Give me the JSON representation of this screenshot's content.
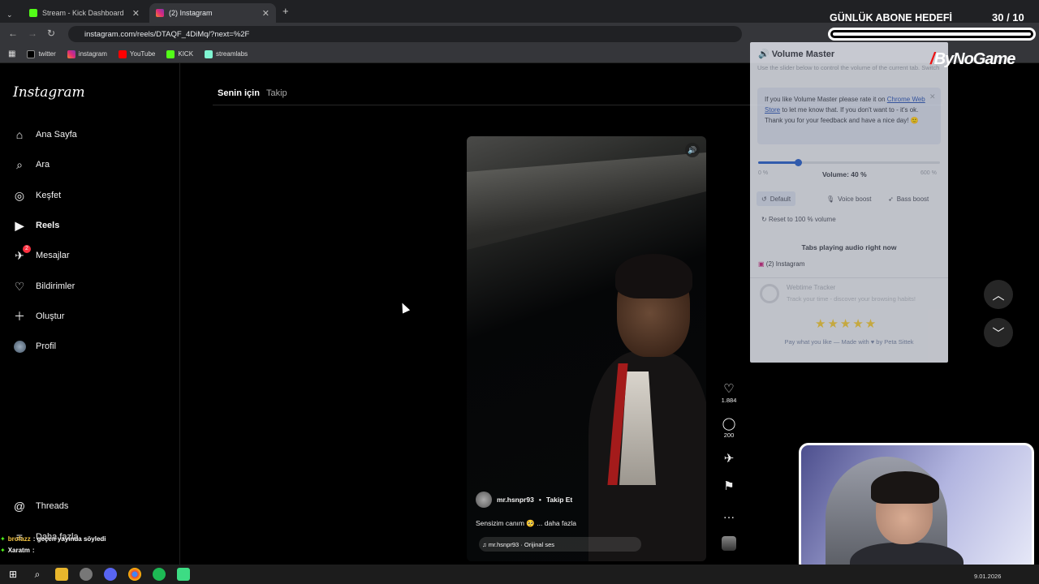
{
  "browser": {
    "tabs": [
      {
        "label": "Stream - Kick Dashboard",
        "icon": "kick-icon"
      },
      {
        "label": "(2) Instagram",
        "icon": "instagram-icon"
      }
    ],
    "new_tab": "+",
    "url": "instagram.com/reels/DTAQF_4DiMq/?next=%2F",
    "bookmarks": [
      "twitter",
      "instagram",
      "YouTube",
      "KICK",
      "streamlabs"
    ]
  },
  "instagram": {
    "logo": "Instagram",
    "nav": [
      {
        "label": "Ana Sayfa",
        "icon": "home-icon"
      },
      {
        "label": "Ara",
        "icon": "search-icon"
      },
      {
        "label": "Keşfet",
        "icon": "compass-icon"
      },
      {
        "label": "Reels",
        "icon": "reels-icon"
      },
      {
        "label": "Mesajlar",
        "icon": "messages-icon",
        "badge": "2"
      },
      {
        "label": "Bildirimler",
        "icon": "heart-icon"
      },
      {
        "label": "Oluştur",
        "icon": "plus-icon"
      },
      {
        "label": "Profil",
        "icon": "avatar-icon"
      }
    ],
    "nav_bottom": [
      {
        "label": "Threads",
        "icon": "threads-icon"
      },
      {
        "label": "Daha fazla",
        "icon": "menu-icon"
      }
    ],
    "feed_tabs": {
      "active": "Senin için",
      "other": "Takip"
    },
    "reel": {
      "username": "mr.hsnpr93",
      "separator": "•",
      "follow": "Takip Et",
      "caption": "Sensizim canım 🥺 ... daha fazla",
      "audio": "♫ mr.hsnpr93 · Orijinal ses",
      "likes": "1.884",
      "comments": "200"
    }
  },
  "volume_master": {
    "title": "Volume Master",
    "description": "Use the slider below to control the volume of the current tab. Switch to any tab playing audio with just one click.",
    "rate_text_1": "If you like Volume Master please rate it on",
    "rate_link": "Chrome Web Store",
    "rate_text_2": "to let me know that. If you don't want to - it's ok. Thank you for your feedback and have a nice day! 🙂",
    "min": "0 %",
    "max": "600 %",
    "volume_label": "Volume: 40 %",
    "volume_fraction": 0.0667,
    "buttons": [
      "Default",
      "Voice boost",
      "Bass boost"
    ],
    "reset": "Reset to 100 % volume",
    "tabs_heading": "Tabs playing audio right now",
    "tab_item": "(2) Instagram",
    "tracker_title": "Webtime Tracker",
    "tracker_desc": "Track your time - discover your browsing habits!",
    "stars": "★★★★★",
    "footer": "Pay what you like — Made with ♥ by Peta Sittek"
  },
  "overlay": {
    "goal_label": "GÜNLÜK ABONE HEDEFİ",
    "goal_count": "30 / 10",
    "goal_fraction": 1.0,
    "brand": "ByNoGame"
  },
  "chat": [
    {
      "user": "brofazz",
      "message": ": geçen yayında söyledi"
    },
    {
      "user": "Xaratm",
      "message": ":"
    }
  ],
  "taskbar": {
    "date": "9.01.2026"
  }
}
